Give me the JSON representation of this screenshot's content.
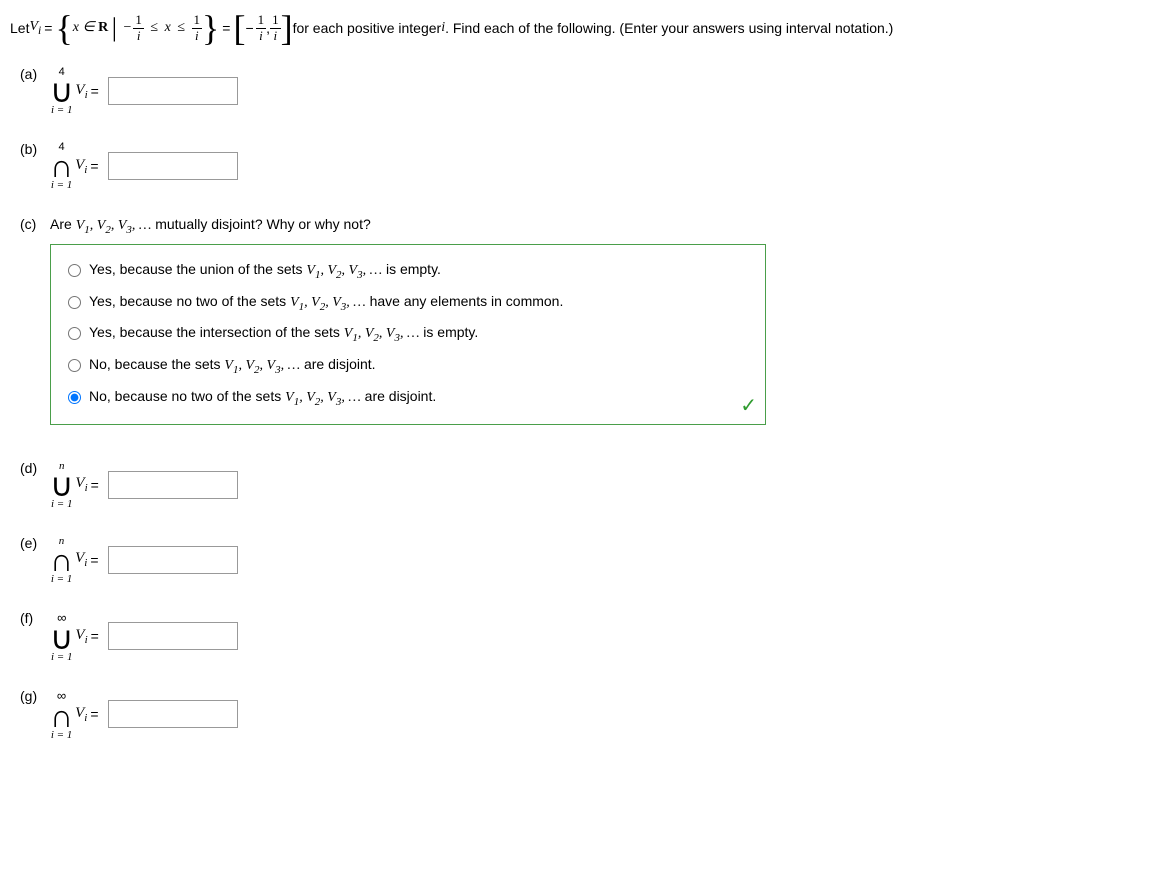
{
  "intro": {
    "pre": "Let ",
    "Vi": "V",
    "Vi_sub": "i",
    "eq1": " = ",
    "x_in": "x ∈ ",
    "R": "R",
    "bar": " | ",
    "neg1": "−",
    "frac1_num": "1",
    "frac1_den": "i",
    "leq1": " ≤ ",
    "x": "x",
    "leq2": " ≤ ",
    "frac2_num": "1",
    "frac2_den": "i",
    "eq2": " = ",
    "neg2": "−",
    "frac3_num": "1",
    "frac3_den": "i",
    "comma": ", ",
    "frac4_num": "1",
    "frac4_den": "i",
    "post": " for each positive integer ",
    "ivar": "i",
    "post2": ". Find each of the following. (Enter your answers using interval notation.)"
  },
  "parts": {
    "a": {
      "label": "(a)",
      "top": "4",
      "op": "∪",
      "bot": "i = 1",
      "Vi": "V",
      "sub": "i",
      "eq": "="
    },
    "b": {
      "label": "(b)",
      "top": "4",
      "op": "∩",
      "bot": "i = 1",
      "Vi": "V",
      "sub": "i",
      "eq": "="
    },
    "d": {
      "label": "(d)",
      "top": "n",
      "op": "∪",
      "bot": "i = 1",
      "Vi": "V",
      "sub": "i",
      "eq": "="
    },
    "e": {
      "label": "(e)",
      "top": "n",
      "op": "∩",
      "bot": "i = 1",
      "Vi": "V",
      "sub": "i",
      "eq": "="
    },
    "f": {
      "label": "(f)",
      "top": "∞",
      "op": "∪",
      "bot": "i = 1",
      "Vi": "V",
      "sub": "i",
      "eq": "="
    },
    "g": {
      "label": "(g)",
      "top": "∞",
      "op": "∩",
      "bot": "i = 1",
      "Vi": "V",
      "sub": "i",
      "eq": "="
    }
  },
  "part_c": {
    "label": "(c)",
    "q_pre": "Are ",
    "vlist": "V₁, V₂, V₃, …",
    "q_post": " mutually disjoint? Why or why not?",
    "options": [
      "Yes, because the union of the sets V₁, V₂, V₃, … is empty.",
      "Yes, because no two of the sets V₁, V₂, V₃, … have any elements in common.",
      "Yes, because the intersection of the sets V₁, V₂, V₃, … is empty.",
      "No, because the sets V₁, V₂, V₃, … are disjoint.",
      "No, because no two of the sets V₁, V₂, V₃, … are disjoint."
    ],
    "selected": 4
  }
}
